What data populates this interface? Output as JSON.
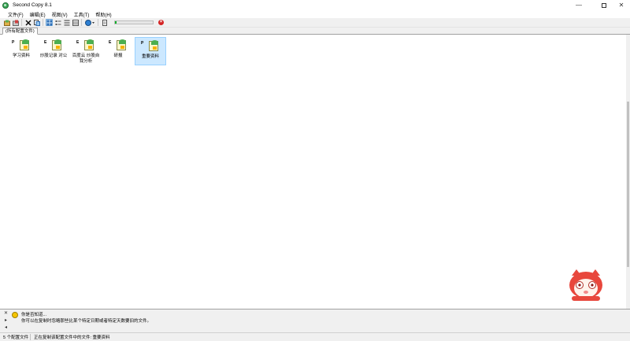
{
  "window": {
    "title": "Second Copy 8.1",
    "minimize_glyph": "—",
    "close_glyph": "✕"
  },
  "menu": [
    "文件(F)",
    "编辑(E)",
    "视图(V)",
    "工具(T)",
    "帮助(H)"
  ],
  "toolbar": {
    "progress_fraction": 0.04,
    "stop_glyph": "×"
  },
  "tab": {
    "label": "(所有配置文件)"
  },
  "jobs": [
    {
      "marker": "P",
      "label": "学习资料",
      "selected": false
    },
    {
      "marker": "E",
      "label": "炒股记录 对公",
      "selected": false
    },
    {
      "marker": "E",
      "label": "百度云 炒股自我分析",
      "selected": false
    },
    {
      "marker": "E",
      "label": "研报",
      "selected": false
    },
    {
      "marker": "P",
      "label": "重要资料",
      "selected": true
    }
  ],
  "tip": {
    "title": "你是否知道...",
    "text": "你可以在复制时忽略那些比某个特定日期或者特定天数要旧的文件。",
    "close_glyph": "✕",
    "next_glyph": "▸",
    "prev_glyph": "◂"
  },
  "status": {
    "count": "5 个配置文件",
    "message": "正在复制该配置文件中的文件: 重要资料"
  },
  "colors": {
    "progress": "#06b025",
    "selection": "#cce8ff"
  }
}
